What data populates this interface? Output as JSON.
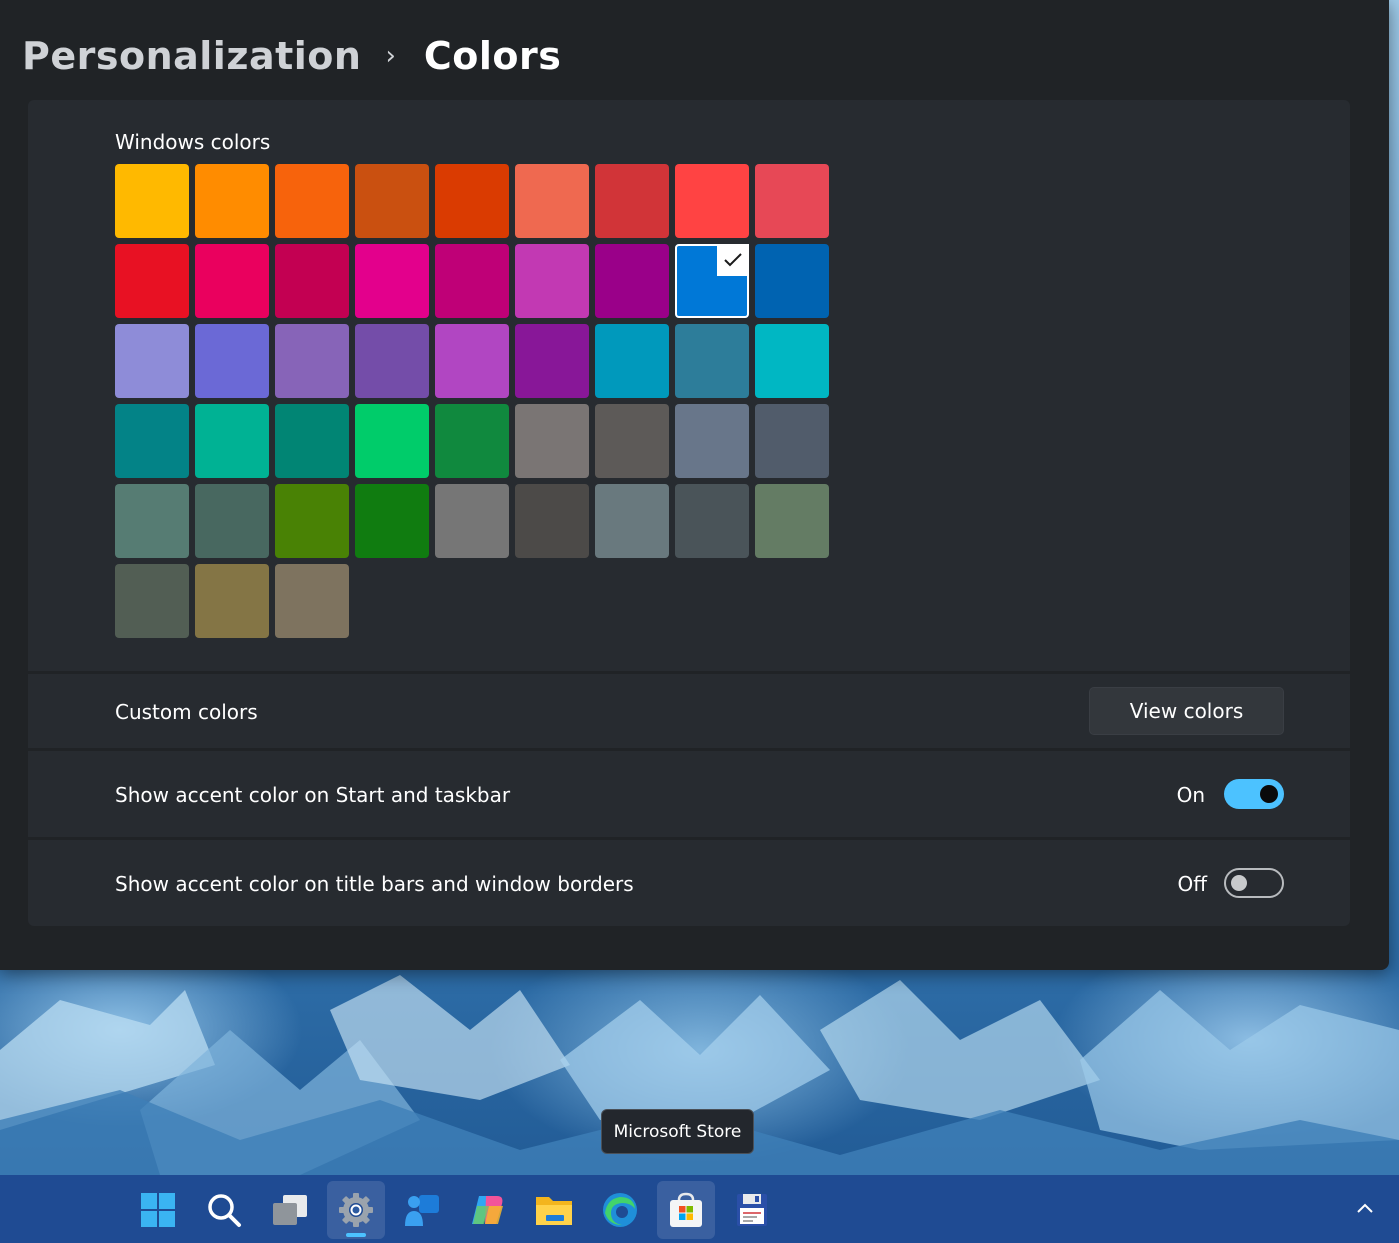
{
  "breadcrumb": {
    "parent": "Personalization",
    "separator": "›",
    "current": "Colors"
  },
  "windows_colors": {
    "label": "Windows colors",
    "selected_index": 16,
    "swatches": [
      "#ffb900",
      "#ff8c00",
      "#f7630c",
      "#ca5010",
      "#da3b01",
      "#ef6950",
      "#d13438",
      "#ff4343",
      "#e74856",
      "#e81123",
      "#ea005e",
      "#c30052",
      "#e3008c",
      "#bf0077",
      "#c239b3",
      "#9a0089",
      "#0078d7",
      "#0063b1",
      "#8e8cd8",
      "#6b69d6",
      "#8764b8",
      "#744da9",
      "#b146c2",
      "#881798",
      "#0099bc",
      "#2d7d9a",
      "#00b7c3",
      "#038387",
      "#00b294",
      "#018574",
      "#00cc6a",
      "#10893e",
      "#7a7574",
      "#5d5a58",
      "#68768a",
      "#515c6b",
      "#567c73",
      "#486860",
      "#498205",
      "#107c10",
      "#767676",
      "#4c4a48",
      "#69797e",
      "#4a5459",
      "#647c64",
      "#525e54",
      "#847545",
      "#7e735f"
    ]
  },
  "custom_colors": {
    "label": "Custom colors",
    "button_label": "View colors"
  },
  "accent_start": {
    "label": "Show accent color on Start and taskbar",
    "state_label": "On",
    "on": true
  },
  "accent_title": {
    "label": "Show accent color on title bars and window borders",
    "state_label": "Off",
    "on": false
  },
  "tooltip": {
    "text": "Microsoft Store"
  },
  "taskbar": {
    "icons": [
      "windows-start-icon",
      "search-icon",
      "task-view-icon",
      "settings-icon",
      "teams-icon",
      "copilot-icon",
      "file-explorer-icon",
      "edge-icon",
      "microsoft-store-icon",
      "floppy-app-icon"
    ],
    "active": "settings-icon",
    "hovered": "microsoft-store-icon",
    "accent": "#4cc2ff"
  }
}
